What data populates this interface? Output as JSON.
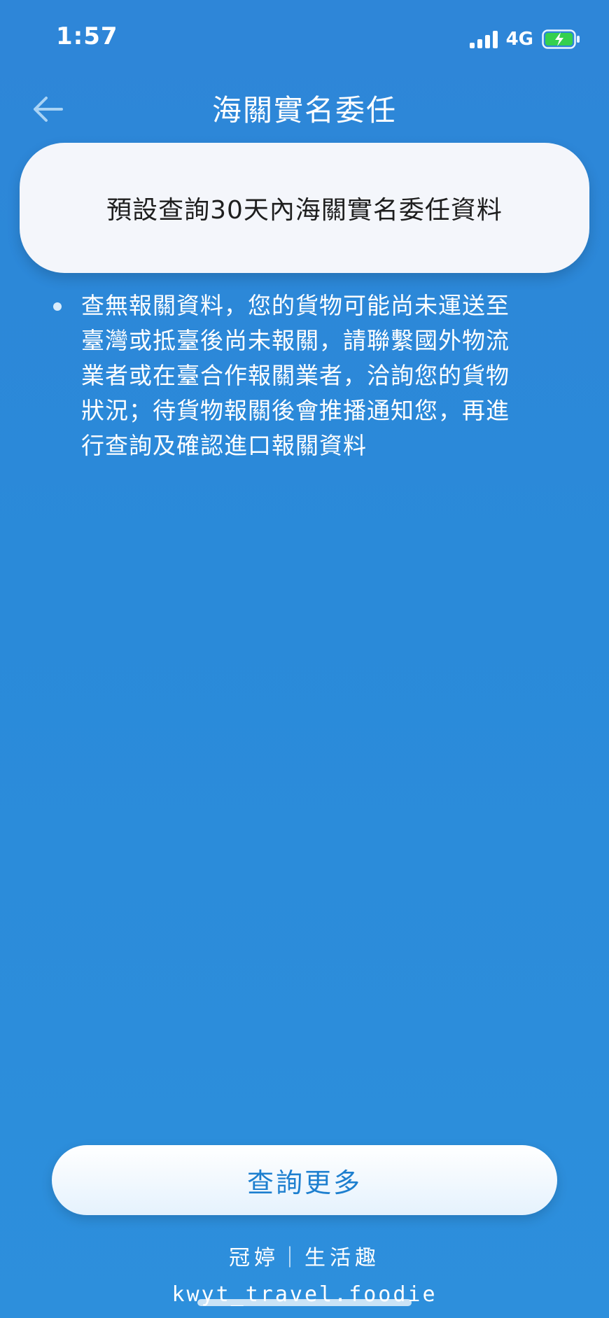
{
  "status_bar": {
    "time": "1:57",
    "network": "4G",
    "icons": [
      "signal-icon",
      "battery-charging-icon"
    ]
  },
  "header": {
    "title": "海關實名委任",
    "back_icon": "arrow-left-icon"
  },
  "info_card": {
    "text": "預設查詢30天內海關實名委任資料"
  },
  "notice": {
    "lines": [
      "查無報關資料，您的貨物可能尚未運送至",
      "臺灣或抵臺後尚未報關，請聯繫國外物流",
      "業者或在臺合作報關業者，洽詢您的貨物",
      "狀況；待貨物報關後會推播通知您，再進",
      "行查詢及確認進口報關資料"
    ]
  },
  "bottom": {
    "query_more_label": "查詢更多"
  },
  "watermark": {
    "line1": "冠婷｜生活趣",
    "line2": "kwyt_travel.foodie"
  },
  "colors": {
    "background": "#2e86d8",
    "card": "#f4f6fb",
    "button_text": "#1d7fcf"
  }
}
